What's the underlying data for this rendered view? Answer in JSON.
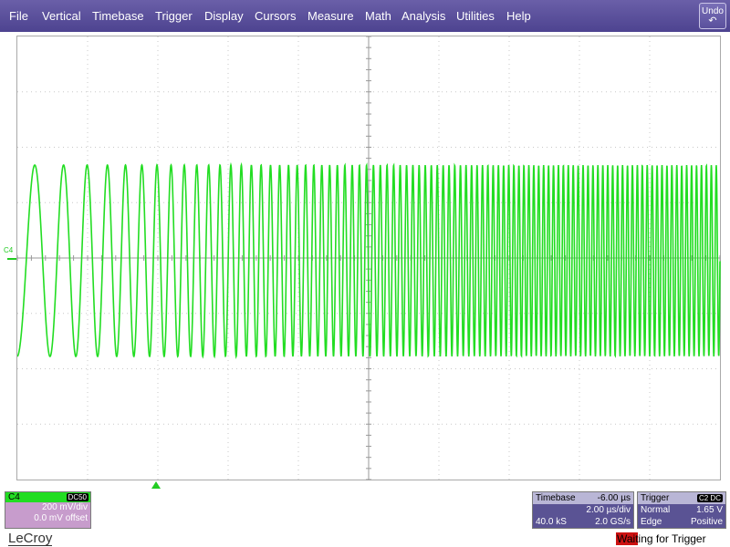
{
  "menu": {
    "items": [
      "File",
      "Vertical",
      "Timebase",
      "Trigger",
      "Display",
      "Cursors",
      "Measure",
      "Math",
      "Analysis",
      "Utilities",
      "Help"
    ],
    "undo_label": "Undo",
    "undo_icon": "undo-arrow-icon"
  },
  "trace": {
    "channel_label": "C4",
    "color": "#22dd22"
  },
  "channel_box": {
    "name": "C4",
    "coupling": "DC50",
    "volts_per_div": "200 mV/div",
    "offset": "0.0 mV offset",
    "header_color": "#22dd22",
    "body_color": "#c79ccc"
  },
  "timebase_box": {
    "title": "Timebase",
    "delay": "-6.00 µs",
    "time_per_div": "2.00 µs/div",
    "samples": "40.0 kS",
    "sample_rate": "2.0 GS/s"
  },
  "trigger_box": {
    "title": "Trigger",
    "source": "C2 DC",
    "mode": "Normal",
    "level": "1.65 V",
    "type": "Edge",
    "slope": "Positive"
  },
  "footer": {
    "logo": "LeCroy",
    "status": "Waiting for Trigger",
    "status_color": "#cc1111"
  }
}
